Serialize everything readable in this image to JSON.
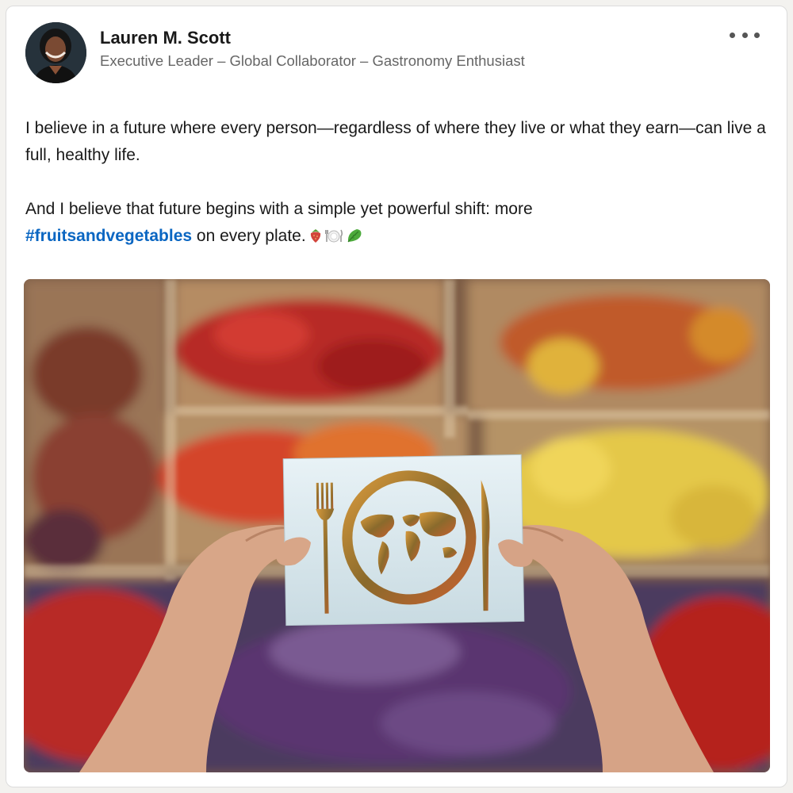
{
  "post": {
    "author": {
      "name": "Lauren M. Scott",
      "headline": "Executive Leader – Global Collaborator – Gastronomy Enthusiast"
    },
    "text": {
      "paragraph1": "I believe in a future where every person—regardless of where they live or what they earn—can live a full, healthy life.",
      "paragraph2_part1": "And I believe that future begins with a simple yet powerful shift: more",
      "hashtag": "#fruitsandvegetables",
      "paragraph2_part2": " on every plate."
    },
    "emojis": [
      "strawberry-icon",
      "plate-cutlery-icon",
      "leafy-greens-icon"
    ],
    "menu_icon": "more-options-icon"
  },
  "colors": {
    "hashtag": "#0a66c2",
    "name": "#191919",
    "headline": "#666666"
  }
}
